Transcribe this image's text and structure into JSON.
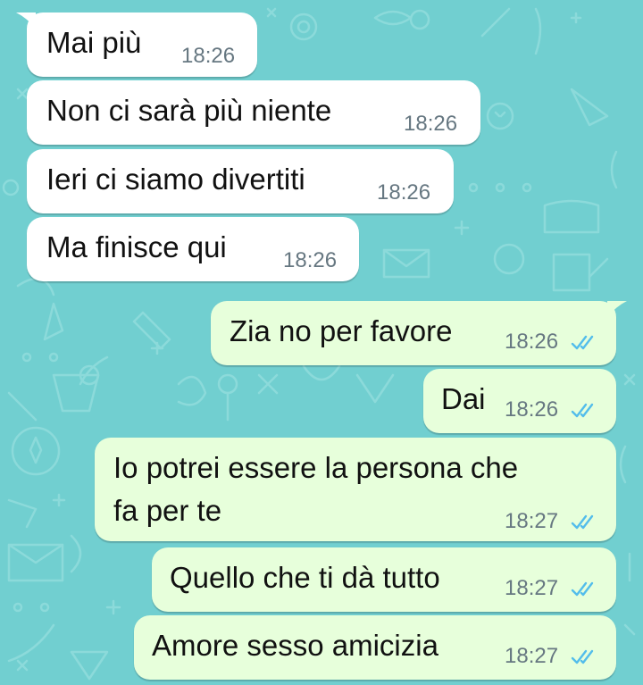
{
  "chat": {
    "incoming": [
      {
        "text": "Mai più",
        "time": "18:26"
      },
      {
        "text": "Non ci sarà più niente",
        "time": "18:26"
      },
      {
        "text": "Ieri ci siamo divertiti",
        "time": "18:26"
      },
      {
        "text": "Ma finisce qui",
        "time": "18:26"
      }
    ],
    "outgoing": [
      {
        "text": "Zia no per favore",
        "time": "18:26",
        "status_icon": "double-check-read-icon"
      },
      {
        "text": "Dai",
        "time": "18:26",
        "status_icon": "double-check-read-icon"
      },
      {
        "text_line1": "Io potrei essere la persona che",
        "text_line2": "fa per te",
        "time": "18:27",
        "status_icon": "double-check-read-icon"
      },
      {
        "text": "Quello che ti dà tutto",
        "time": "18:27",
        "status_icon": "double-check-read-icon"
      },
      {
        "text": "Amore sesso amicizia",
        "time": "18:27",
        "status_icon": "double-check-read-icon"
      }
    ]
  },
  "colors": {
    "wallpaper": "#71cfd0",
    "incoming_bubble": "#ffffff",
    "outgoing_bubble": "#e7ffdb",
    "timestamp": "#667781",
    "read_ticks": "#53bdeb"
  }
}
